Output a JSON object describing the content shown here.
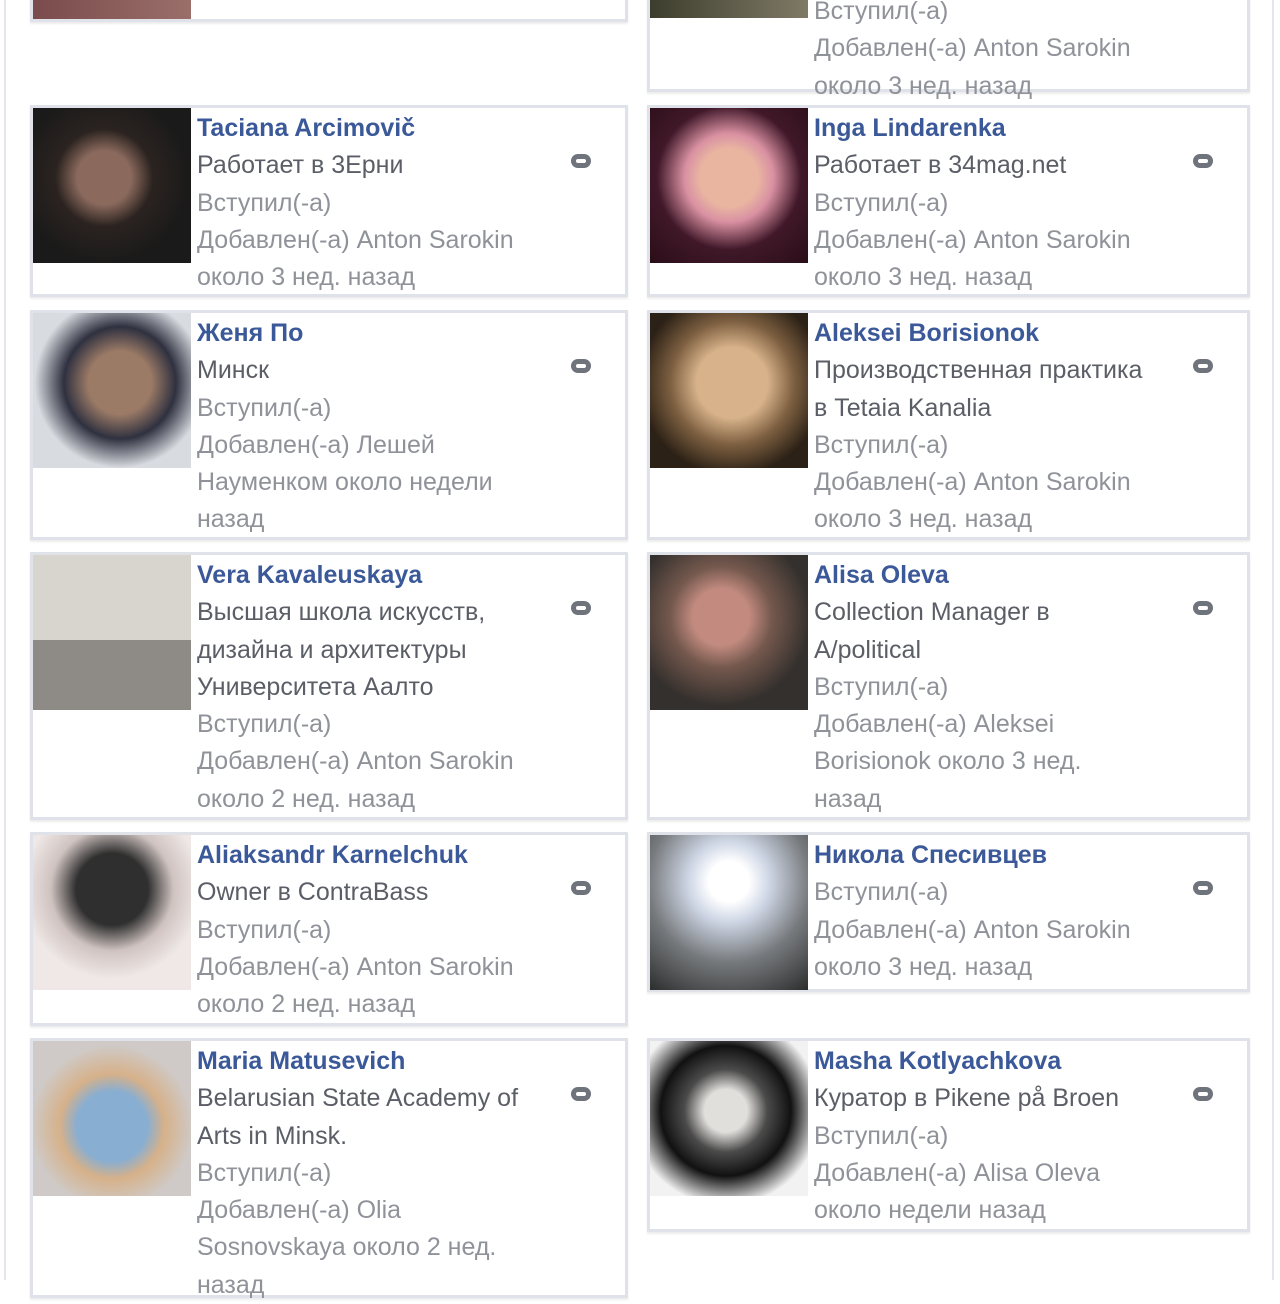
{
  "members": {
    "top_left_partial": {
      "line": "..."
    },
    "top_right_partial": {
      "line1": "Вступил(-а)",
      "line2": "Добавлен(-а) Anton Sarokin",
      "line3": "около 3 нед. назад"
    },
    "cards": [
      {
        "name": "Taciana Arcimovič",
        "lines": [
          "Работает в 3Ерни",
          "Вступил(-а)",
          "Добавлен(-а) Anton Sarokin",
          "около 3 нед. назад"
        ]
      },
      {
        "name": "Inga Lindarenka",
        "lines": [
          "Работает в 34mag.net",
          "Вступил(-а)",
          "Добавлен(-а) Anton Sarokin",
          "около 3 нед. назад"
        ]
      },
      {
        "name": "Женя По",
        "lines": [
          "Минск",
          "Вступил(-а)",
          "Добавлен(-а) Лешей",
          "Науменком около недели",
          "назад"
        ]
      },
      {
        "name": "Aleksei Borisionok",
        "lines": [
          "Производственная практика",
          "в Tetaia Kanalia",
          "Вступил(-а)",
          "Добавлен(-а) Anton Sarokin",
          "около 3 нед. назад"
        ]
      },
      {
        "name": "Vera Kavaleuskaya",
        "lines": [
          "Высшая школа искусств,",
          "дизайна и архитектуры",
          "Университета Аалто",
          "Вступил(-а)",
          "Добавлен(-а) Anton Sarokin",
          "около 2 нед. назад"
        ]
      },
      {
        "name": "Alisa Oleva",
        "lines": [
          "Collection Manager в",
          "A/political",
          "Вступил(-а)",
          "Добавлен(-а) Aleksei",
          "Borisionok около 3 нед.",
          "назад"
        ]
      },
      {
        "name": "Aliaksandr Karnelchuk",
        "lines": [
          "Owner в ContraBass",
          "Вступил(-а)",
          "Добавлен(-а) Anton Sarokin",
          "около 2 нед. назад"
        ]
      },
      {
        "name": "Никола Спесивцев",
        "lines": [
          "Вступил(-а)",
          "Добавлен(-а) Anton Sarokin",
          "около 3 нед. назад"
        ]
      },
      {
        "name": "Maria Matusevich",
        "lines": [
          "Belarusian State Academy of",
          "Arts in Minsk.",
          "Вступил(-а)",
          "Добавлен(-а) Olia",
          "Sosnovskaya около 2 нед.",
          "назад"
        ]
      },
      {
        "name": "Masha Kotlyachkova",
        "lines": [
          "Куратор в Pikene på Broen",
          "Вступил(-а)",
          "Добавлен(-а) Alisa Oleva",
          "около недели назад"
        ]
      }
    ]
  },
  "colors": {
    "name": "#3b5998",
    "meta": "#8f9299",
    "border": "#dfe2e8"
  },
  "icons": {
    "options": "gear-icon"
  }
}
